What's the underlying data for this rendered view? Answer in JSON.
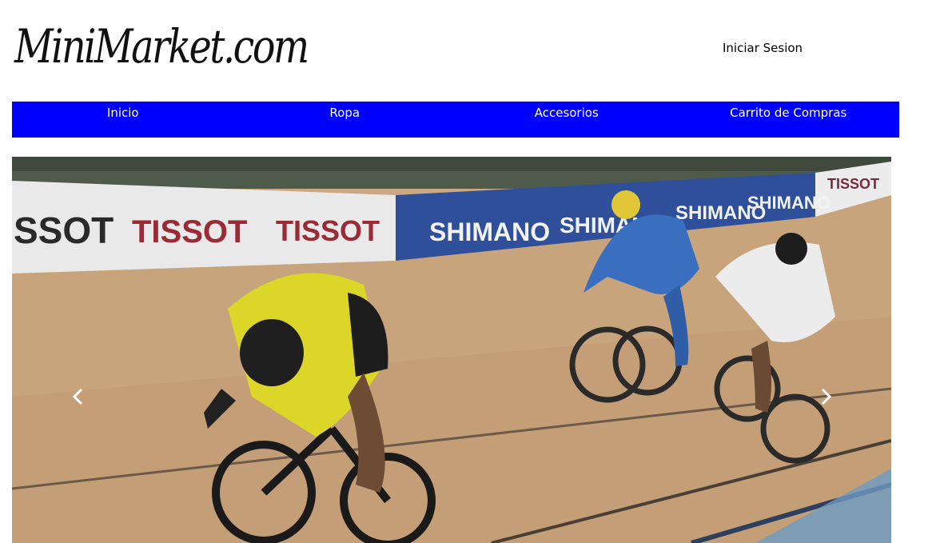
{
  "header": {
    "logo_text": "MiniMarket.com",
    "login_label": "Iniciar Sesion"
  },
  "navbar": {
    "items": [
      {
        "label": "Inicio"
      },
      {
        "label": "Ropa"
      },
      {
        "label": "Accesorios"
      },
      {
        "label": "Carrito de Compras"
      }
    ],
    "background_color": "#0000ff",
    "text_color": "#ffffff"
  },
  "carousel": {
    "prev_icon": "chevron-left-icon",
    "next_icon": "chevron-right-icon",
    "slide_banner_texts": [
      "SSOT",
      "TISSOT",
      "TISSOT",
      "SHIMANO",
      "SHIMANO",
      "SHIMANO",
      "SHIMANO",
      "TISSOT"
    ]
  }
}
